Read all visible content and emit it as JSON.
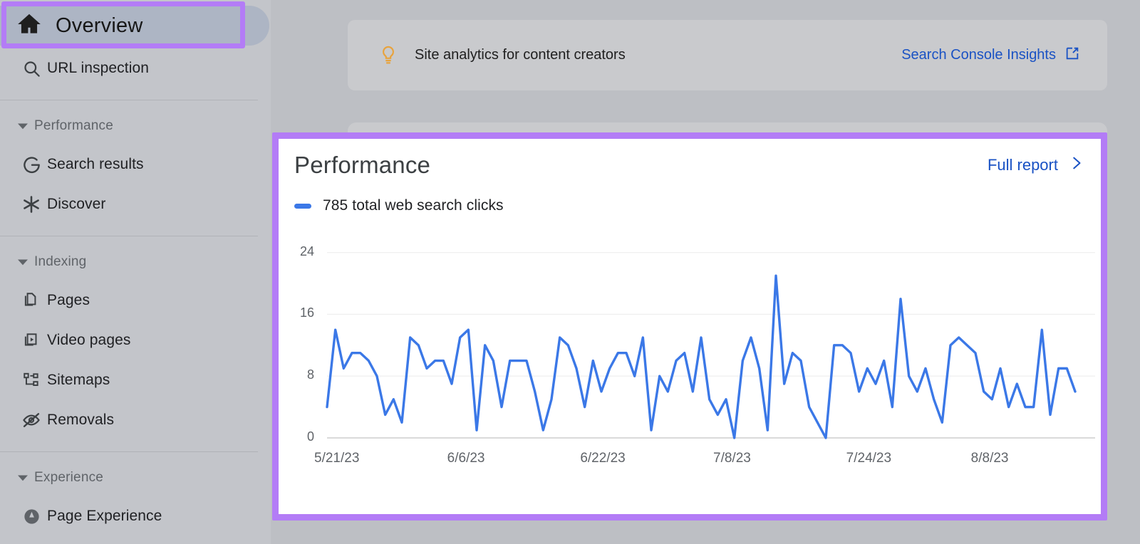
{
  "theme": {
    "purple_highlight": "#b37cf6",
    "sidebar_bg": "#c3c5ca",
    "selected_pill": "#adb5c4",
    "link_blue": "#1a52c4",
    "chart_line": "#3b78e7",
    "bulb_amber": "#e8a33d",
    "page_bg": "#bdbfc4"
  },
  "sidebar": {
    "selected": {
      "label": "Overview",
      "icon": "home-icon"
    },
    "url_inspection": {
      "label": "URL inspection",
      "icon": "search-icon"
    },
    "sections": [
      {
        "label": "Performance",
        "icon": "caret-down-icon",
        "items": [
          {
            "label": "Search results",
            "icon": "google-g-icon"
          },
          {
            "label": "Discover",
            "icon": "asterisk-icon"
          }
        ]
      },
      {
        "label": "Indexing",
        "icon": "caret-down-icon",
        "items": [
          {
            "label": "Pages",
            "icon": "pages-copy-icon"
          },
          {
            "label": "Video pages",
            "icon": "video-pages-icon"
          },
          {
            "label": "Sitemaps",
            "icon": "sitemaps-tree-icon"
          },
          {
            "label": "Removals",
            "icon": "eye-off-icon"
          }
        ]
      },
      {
        "label": "Experience",
        "icon": "caret-down-icon",
        "items": [
          {
            "label": "Page Experience",
            "icon": "gauge-icon"
          }
        ]
      }
    ]
  },
  "banner": {
    "icon": "lightbulb-icon",
    "text": "Site analytics for content creators",
    "link_label": "Search Console Insights",
    "link_icon": "open-in-new-icon"
  },
  "performance_card": {
    "title": "Performance",
    "full_report_label": "Full report",
    "full_report_icon": "chevron-right-icon",
    "legend_label": "785 total web search clicks",
    "legend_marker": "line-dash-marker"
  },
  "chart_data": {
    "type": "line",
    "title": "Performance",
    "series_name": "785 total web search clicks",
    "total_clicks": 785,
    "xlabel": "",
    "ylabel": "",
    "ylim": [
      0,
      26
    ],
    "yticks": [
      0,
      8,
      16,
      24
    ],
    "ytick_labels": [
      "0",
      "8",
      "16",
      "24"
    ],
    "grid": true,
    "legend_position": "top-left",
    "color": "#3b78e7",
    "xtick_labels": [
      "5/21/23",
      "6/6/23",
      "6/22/23",
      "7/8/23",
      "7/24/23",
      "8/8/23"
    ],
    "xtick_indices": [
      0,
      16,
      32,
      48,
      64,
      79
    ],
    "x_start": "5/21/23",
    "x_end": "8/18/23",
    "n_points": 91,
    "values": [
      4,
      14,
      9,
      11,
      11,
      10,
      8,
      3,
      5,
      2,
      13,
      12,
      9,
      10,
      10,
      7,
      13,
      14,
      1,
      12,
      10,
      4,
      10,
      10,
      10,
      6,
      1,
      5,
      13,
      12,
      9,
      4,
      10,
      6,
      9,
      11,
      11,
      8,
      13,
      1,
      8,
      6,
      10,
      11,
      6,
      13,
      5,
      3,
      5,
      0,
      10,
      13,
      9,
      1,
      21,
      7,
      11,
      10,
      4,
      2,
      0,
      12,
      12,
      11,
      6,
      9,
      7,
      10,
      4,
      18,
      8,
      6,
      9,
      5,
      2,
      12,
      13,
      12,
      11,
      6,
      5,
      9,
      4,
      7,
      4,
      4,
      14,
      3,
      9,
      9,
      6
    ],
    "peak_value": 21,
    "peak_label": "7/8/23"
  }
}
